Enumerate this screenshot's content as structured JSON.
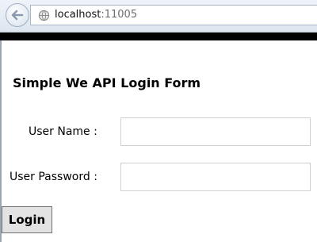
{
  "browser": {
    "url_host": "localhost",
    "url_port": ":11005"
  },
  "form": {
    "title": "Simple We API Login Form",
    "username_label": "User Name :",
    "username_value": "",
    "password_label": "User Password :",
    "password_value": "",
    "login_label": "Login"
  },
  "icons": {
    "back": "back-arrow-icon",
    "globe": "globe-icon"
  },
  "colors": {
    "band": "#000000",
    "button_bg": "#e3e3e3"
  }
}
